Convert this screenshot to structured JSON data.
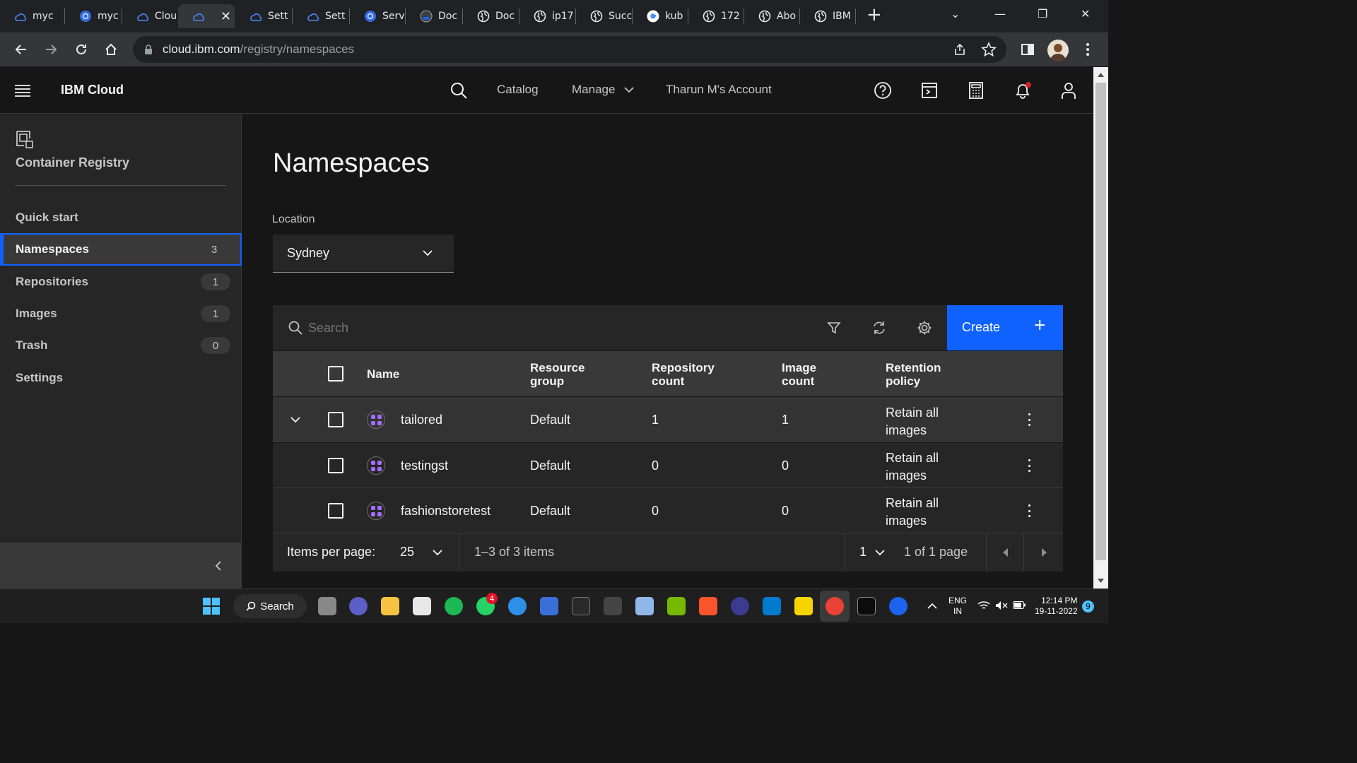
{
  "browser": {
    "tabs": [
      {
        "label": "myc",
        "icon": "ibm-cloud-icon"
      },
      {
        "label": "myc",
        "icon": "kubernetes-icon"
      },
      {
        "label": "Clou",
        "icon": "ibm-cloud-icon"
      },
      {
        "label": "",
        "icon": "ibm-cloud-icon",
        "active": true
      },
      {
        "label": "Sett",
        "icon": "ibm-cloud-icon"
      },
      {
        "label": "Sett",
        "icon": "ibm-cloud-icon"
      },
      {
        "label": "Serv",
        "icon": "kubernetes-icon"
      },
      {
        "label": "Doc",
        "icon": "docker-icon"
      },
      {
        "label": "Doc",
        "icon": "globe-icon"
      },
      {
        "label": "ip17",
        "icon": "globe-icon"
      },
      {
        "label": "Succ",
        "icon": "globe-icon"
      },
      {
        "label": "kub",
        "icon": "google-icon"
      },
      {
        "label": "172",
        "icon": "globe-icon"
      },
      {
        "label": "Abo",
        "icon": "globe-icon"
      },
      {
        "label": "IBM",
        "icon": "globe-icon"
      }
    ],
    "url_host": "cloud.ibm.com",
    "url_path": "/registry/namespaces"
  },
  "header": {
    "brand": "IBM Cloud",
    "catalog": "Catalog",
    "manage": "Manage",
    "account": "Tharun M's Account"
  },
  "sidebar": {
    "title": "Container Registry",
    "items": [
      {
        "label": "Quick start",
        "count": ""
      },
      {
        "label": "Namespaces",
        "count": "3",
        "active": true
      },
      {
        "label": "Repositories",
        "count": "1"
      },
      {
        "label": "Images",
        "count": "1"
      },
      {
        "label": "Trash",
        "count": "0"
      },
      {
        "label": "Settings",
        "count": ""
      }
    ]
  },
  "main": {
    "title": "Namespaces",
    "location_label": "Location",
    "location_value": "Sydney",
    "search_placeholder": "Search",
    "create_label": "Create",
    "columns": {
      "name": "Name",
      "resource_group_1": "Resource",
      "resource_group_2": "group",
      "repo_count_1": "Repository",
      "repo_count_2": "count",
      "image_count_1": "Image",
      "image_count_2": "count",
      "retention_1": "Retention",
      "retention_2": "policy"
    },
    "rows": [
      {
        "name": "tailored",
        "group": "Default",
        "repos": "1",
        "images": "1",
        "retention_1": "Retain all",
        "retention_2": "images"
      },
      {
        "name": "testingst",
        "group": "Default",
        "repos": "0",
        "images": "0",
        "retention_1": "Retain all",
        "retention_2": "images"
      },
      {
        "name": "fashionstoretest",
        "group": "Default",
        "repos": "0",
        "images": "0",
        "retention_1": "Retain all",
        "retention_2": "images"
      }
    ],
    "pagination": {
      "items_per_page_label": "Items per page:",
      "items_per_page": "25",
      "range": "1–3 of 3 items",
      "page": "1",
      "page_of": "1 of 1 page"
    }
  },
  "taskbar": {
    "search_label": "Search",
    "whatsapp_badge": "4",
    "lang_1": "ENG",
    "lang_2": "IN",
    "time": "12:14 PM",
    "date": "19-11-2022",
    "notification_count": "9"
  },
  "colors": {
    "accent": "#0f62fe",
    "namespace_icon": "#a56eff",
    "notification_dot": "#da1e28"
  }
}
